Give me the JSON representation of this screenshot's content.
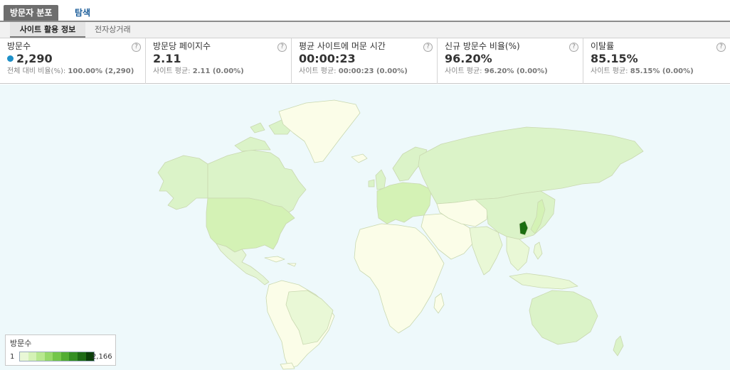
{
  "tabs": {
    "active": "방문자 분포",
    "explore": "탐색"
  },
  "subtabs": {
    "active": "사이트 활용 정보",
    "other": "전자상거래"
  },
  "metrics": [
    {
      "title": "방문수",
      "value": "2,290",
      "sub_label": "전체 대비 비율(%):",
      "sub_value": "100.00% (2,290)"
    },
    {
      "title": "방문당 페이지수",
      "value": "2.11",
      "sub_label": "사이트 평균:",
      "sub_value": "2.11 (0.00%)"
    },
    {
      "title": "평균 사이트에 머문 시간",
      "value": "00:00:23",
      "sub_label": "사이트 평균:",
      "sub_value": "00:00:23 (0.00%)"
    },
    {
      "title": "신규 방문수 비율(%)",
      "value": "96.20%",
      "sub_label": "사이트 평균:",
      "sub_value": "96.20% (0.00%)"
    },
    {
      "title": "이탈률",
      "value": "85.15%",
      "sub_label": "사이트 평균:",
      "sub_value": "85.15% (0.00%)"
    }
  ],
  "help_glyph": "?",
  "legend": {
    "title": "방문수",
    "min": "1",
    "max": "2,166",
    "colors": [
      "#e9f8d6",
      "#d4f2b5",
      "#b8e88f",
      "#97d96a",
      "#74c64a",
      "#52ad33",
      "#348f23",
      "#1e6b16",
      "#0c3f0a"
    ]
  },
  "map": {
    "ocean_color": "#eef9fb",
    "no_data_color": "#fbfde8",
    "low_color": "#dbf3c8",
    "high_color": "#1a6e10",
    "border_color": "#c9d8b0",
    "highlighted_country": "South Korea"
  },
  "metric_dot_color": "#1e90c8"
}
